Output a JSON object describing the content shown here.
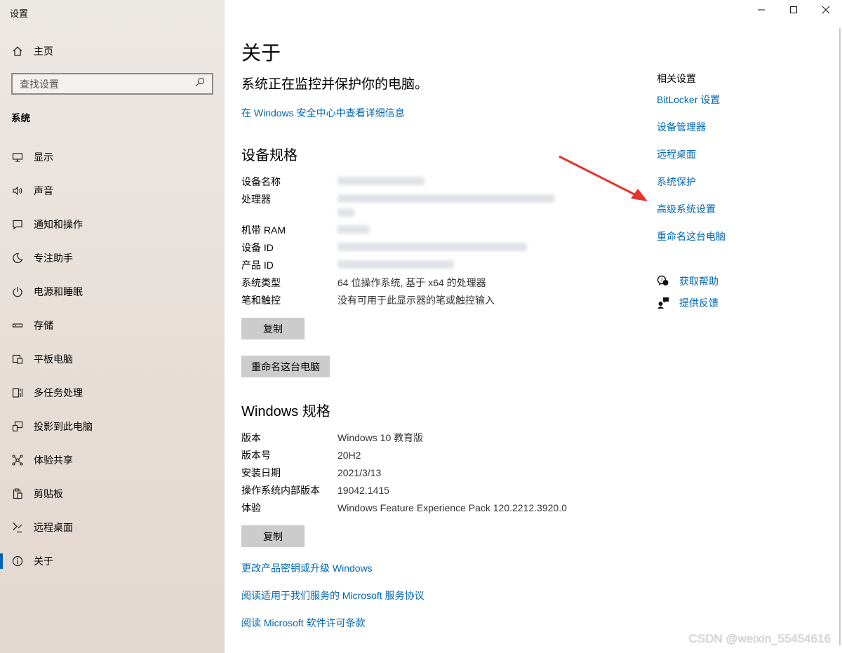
{
  "window": {
    "title": "设置"
  },
  "sidebar": {
    "home_label": "主页",
    "search_placeholder": "查找设置",
    "section": "系统",
    "items": [
      {
        "label": "显示",
        "icon": "monitor-icon"
      },
      {
        "label": "声音",
        "icon": "speaker-icon"
      },
      {
        "label": "通知和操作",
        "icon": "message-icon"
      },
      {
        "label": "专注助手",
        "icon": "moon-icon"
      },
      {
        "label": "电源和睡眠",
        "icon": "power-icon"
      },
      {
        "label": "存储",
        "icon": "storage-icon"
      },
      {
        "label": "平板电脑",
        "icon": "tablet-icon"
      },
      {
        "label": "多任务处理",
        "icon": "multitask-icon"
      },
      {
        "label": "投影到此电脑",
        "icon": "project-icon"
      },
      {
        "label": "体验共享",
        "icon": "share-icon"
      },
      {
        "label": "剪贴板",
        "icon": "clipboard-icon"
      },
      {
        "label": "远程桌面",
        "icon": "remote-icon"
      },
      {
        "label": "关于",
        "icon": "info-icon",
        "active": true
      }
    ]
  },
  "main": {
    "title": "关于",
    "status": "系统正在监控并保护你的电脑。",
    "security_link": "在 Windows 安全中心中查看详细信息",
    "device_specs": {
      "heading": "设备规格",
      "rows": [
        {
          "key": "设备名称",
          "value": ""
        },
        {
          "key": "处理器",
          "value": ""
        },
        {
          "key": "机带 RAM",
          "value": ""
        },
        {
          "key": "设备 ID",
          "value": ""
        },
        {
          "key": "产品 ID",
          "value": ""
        },
        {
          "key": "系统类型",
          "value": "64 位操作系统, 基于 x64 的处理器"
        },
        {
          "key": "笔和触控",
          "value": "没有可用于此显示器的笔或触控输入"
        }
      ],
      "copy_label": "复制",
      "rename_label": "重命名这台电脑"
    },
    "windows_specs": {
      "heading": "Windows 规格",
      "rows": [
        {
          "key": "版本",
          "value": "Windows 10 教育版"
        },
        {
          "key": "版本号",
          "value": "20H2"
        },
        {
          "key": "安装日期",
          "value": "2021/3/13"
        },
        {
          "key": "操作系统内部版本",
          "value": "19042.1415"
        },
        {
          "key": "体验",
          "value": "Windows Feature Experience Pack 120.2212.3920.0"
        }
      ],
      "copy_label": "复制"
    },
    "links": [
      "更改产品密钥或升级 Windows",
      "阅读适用于我们服务的 Microsoft 服务协议",
      "阅读 Microsoft 软件许可条款"
    ]
  },
  "related": {
    "title": "相关设置",
    "links": [
      "BitLocker 设置",
      "设备管理器",
      "远程桌面",
      "系统保护",
      "高级系统设置",
      "重命名这台电脑"
    ],
    "help_label": "获取帮助",
    "feedback_label": "提供反馈"
  },
  "watermark": "CSDN @weixin_55454616",
  "colors": {
    "link": "#0066b4",
    "accent": "#0063b1",
    "arrow": "#e8322b",
    "button": "#cccccc"
  }
}
